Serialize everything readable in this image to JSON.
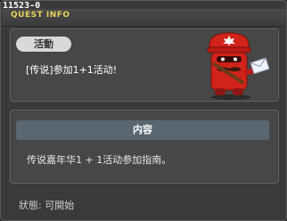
{
  "window": {
    "quest_id": "11523-0",
    "title": "QUEST INFO"
  },
  "quest": {
    "category_badge": "活動",
    "name": "[传说]参加1+1活动!"
  },
  "content": {
    "header": "内容",
    "text": "传说嘉年华1 + 1活动参加指南。"
  },
  "status": {
    "text": "狀態: 可開始"
  },
  "icons": {
    "mascot": "red-postbox-mascot-icon"
  },
  "colors": {
    "title": "#e8d35a",
    "mascot_red": "#d2231a"
  }
}
